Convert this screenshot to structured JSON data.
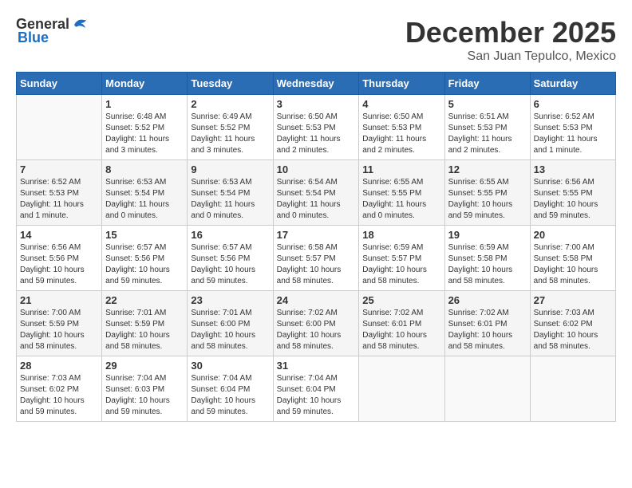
{
  "header": {
    "logo_general": "General",
    "logo_blue": "Blue",
    "month_title": "December 2025",
    "location": "San Juan Tepulco, Mexico"
  },
  "weekdays": [
    "Sunday",
    "Monday",
    "Tuesday",
    "Wednesday",
    "Thursday",
    "Friday",
    "Saturday"
  ],
  "weeks": [
    [
      {
        "day": "",
        "info": ""
      },
      {
        "day": "1",
        "info": "Sunrise: 6:48 AM\nSunset: 5:52 PM\nDaylight: 11 hours\nand 3 minutes."
      },
      {
        "day": "2",
        "info": "Sunrise: 6:49 AM\nSunset: 5:52 PM\nDaylight: 11 hours\nand 3 minutes."
      },
      {
        "day": "3",
        "info": "Sunrise: 6:50 AM\nSunset: 5:53 PM\nDaylight: 11 hours\nand 2 minutes."
      },
      {
        "day": "4",
        "info": "Sunrise: 6:50 AM\nSunset: 5:53 PM\nDaylight: 11 hours\nand 2 minutes."
      },
      {
        "day": "5",
        "info": "Sunrise: 6:51 AM\nSunset: 5:53 PM\nDaylight: 11 hours\nand 2 minutes."
      },
      {
        "day": "6",
        "info": "Sunrise: 6:52 AM\nSunset: 5:53 PM\nDaylight: 11 hours\nand 1 minute."
      }
    ],
    [
      {
        "day": "7",
        "info": "Sunrise: 6:52 AM\nSunset: 5:53 PM\nDaylight: 11 hours\nand 1 minute."
      },
      {
        "day": "8",
        "info": "Sunrise: 6:53 AM\nSunset: 5:54 PM\nDaylight: 11 hours\nand 0 minutes."
      },
      {
        "day": "9",
        "info": "Sunrise: 6:53 AM\nSunset: 5:54 PM\nDaylight: 11 hours\nand 0 minutes."
      },
      {
        "day": "10",
        "info": "Sunrise: 6:54 AM\nSunset: 5:54 PM\nDaylight: 11 hours\nand 0 minutes."
      },
      {
        "day": "11",
        "info": "Sunrise: 6:55 AM\nSunset: 5:55 PM\nDaylight: 11 hours\nand 0 minutes."
      },
      {
        "day": "12",
        "info": "Sunrise: 6:55 AM\nSunset: 5:55 PM\nDaylight: 10 hours\nand 59 minutes."
      },
      {
        "day": "13",
        "info": "Sunrise: 6:56 AM\nSunset: 5:55 PM\nDaylight: 10 hours\nand 59 minutes."
      }
    ],
    [
      {
        "day": "14",
        "info": "Sunrise: 6:56 AM\nSunset: 5:56 PM\nDaylight: 10 hours\nand 59 minutes."
      },
      {
        "day": "15",
        "info": "Sunrise: 6:57 AM\nSunset: 5:56 PM\nDaylight: 10 hours\nand 59 minutes."
      },
      {
        "day": "16",
        "info": "Sunrise: 6:57 AM\nSunset: 5:56 PM\nDaylight: 10 hours\nand 59 minutes."
      },
      {
        "day": "17",
        "info": "Sunrise: 6:58 AM\nSunset: 5:57 PM\nDaylight: 10 hours\nand 58 minutes."
      },
      {
        "day": "18",
        "info": "Sunrise: 6:59 AM\nSunset: 5:57 PM\nDaylight: 10 hours\nand 58 minutes."
      },
      {
        "day": "19",
        "info": "Sunrise: 6:59 AM\nSunset: 5:58 PM\nDaylight: 10 hours\nand 58 minutes."
      },
      {
        "day": "20",
        "info": "Sunrise: 7:00 AM\nSunset: 5:58 PM\nDaylight: 10 hours\nand 58 minutes."
      }
    ],
    [
      {
        "day": "21",
        "info": "Sunrise: 7:00 AM\nSunset: 5:59 PM\nDaylight: 10 hours\nand 58 minutes."
      },
      {
        "day": "22",
        "info": "Sunrise: 7:01 AM\nSunset: 5:59 PM\nDaylight: 10 hours\nand 58 minutes."
      },
      {
        "day": "23",
        "info": "Sunrise: 7:01 AM\nSunset: 6:00 PM\nDaylight: 10 hours\nand 58 minutes."
      },
      {
        "day": "24",
        "info": "Sunrise: 7:02 AM\nSunset: 6:00 PM\nDaylight: 10 hours\nand 58 minutes."
      },
      {
        "day": "25",
        "info": "Sunrise: 7:02 AM\nSunset: 6:01 PM\nDaylight: 10 hours\nand 58 minutes."
      },
      {
        "day": "26",
        "info": "Sunrise: 7:02 AM\nSunset: 6:01 PM\nDaylight: 10 hours\nand 58 minutes."
      },
      {
        "day": "27",
        "info": "Sunrise: 7:03 AM\nSunset: 6:02 PM\nDaylight: 10 hours\nand 58 minutes."
      }
    ],
    [
      {
        "day": "28",
        "info": "Sunrise: 7:03 AM\nSunset: 6:02 PM\nDaylight: 10 hours\nand 59 minutes."
      },
      {
        "day": "29",
        "info": "Sunrise: 7:04 AM\nSunset: 6:03 PM\nDaylight: 10 hours\nand 59 minutes."
      },
      {
        "day": "30",
        "info": "Sunrise: 7:04 AM\nSunset: 6:04 PM\nDaylight: 10 hours\nand 59 minutes."
      },
      {
        "day": "31",
        "info": "Sunrise: 7:04 AM\nSunset: 6:04 PM\nDaylight: 10 hours\nand 59 minutes."
      },
      {
        "day": "",
        "info": ""
      },
      {
        "day": "",
        "info": ""
      },
      {
        "day": "",
        "info": ""
      }
    ]
  ]
}
